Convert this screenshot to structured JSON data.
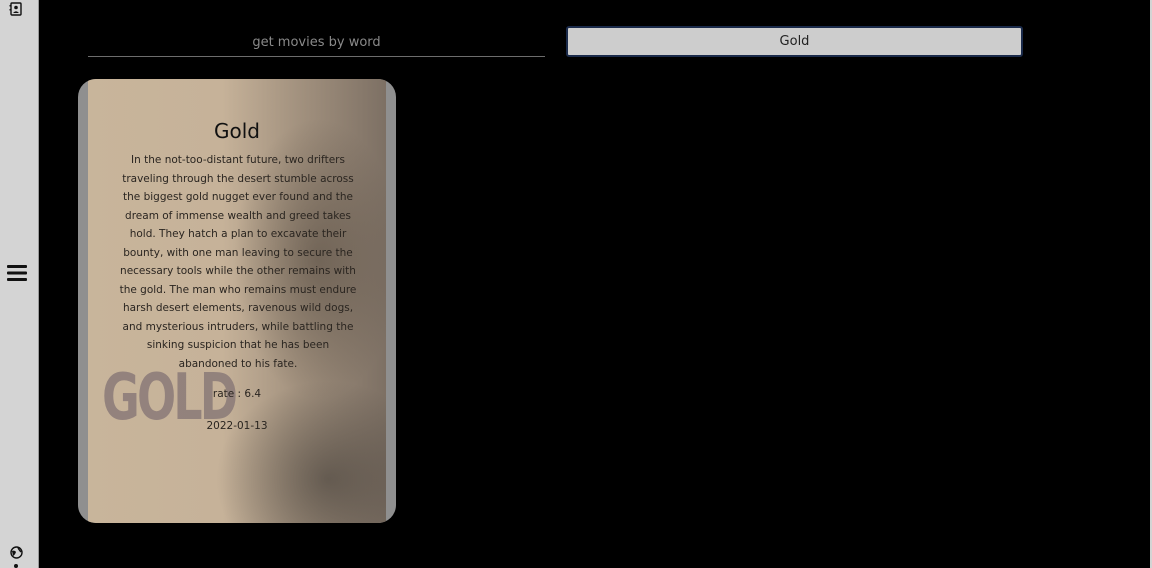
{
  "sidebar": {
    "icons": [
      "contact-icon",
      "hamburger-menu-icon",
      "globe-icon"
    ]
  },
  "search": {
    "placeholder": "get movies by word",
    "value": ""
  },
  "query_box": {
    "value": "Gold"
  },
  "movies": [
    {
      "title": "Gold",
      "poster_text": "GOLD",
      "overview": "In the not-too-distant future, two drifters traveling through the desert stumble across the biggest gold nugget ever found and the dream of immense wealth and greed takes hold. They hatch a plan to excavate their bounty, with one man leaving to secure the necessary tools while the other remains with the gold. The man who remains must endure harsh desert elements, ravenous wild dogs, and mysterious intruders, while battling the sinking suspicion that he has been abandoned to his fate.",
      "rate": "rate : 6.4",
      "date": "2022-01-13"
    }
  ],
  "colors": {
    "background": "#000000",
    "sidebar": "#d4d4d4",
    "card_poster": "#c8b59b"
  }
}
